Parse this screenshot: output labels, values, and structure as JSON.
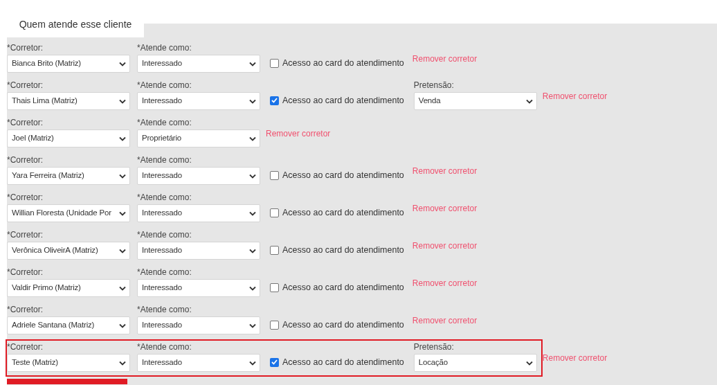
{
  "tab": {
    "label": "Quem atende esse cliente"
  },
  "rows": [
    {
      "corretor_label": "*Corretor:",
      "corretor": "Bianca Brito (Matriz)",
      "atende_label": "*Atende como:",
      "atende": "Interessado",
      "access": {
        "label": "Acesso ao card do atendimento",
        "checked": false
      },
      "remove": "Remover corretor",
      "highlighted": false
    },
    {
      "corretor_label": "*Corretor:",
      "corretor": "Thais Lima (Matriz)",
      "atende_label": "*Atende como:",
      "atende": "Interessado",
      "access": {
        "label": "Acesso ao card do atendimento",
        "checked": true
      },
      "pretensao": {
        "label": "Pretensão:",
        "value": "Venda"
      },
      "remove": "Remover corretor",
      "highlighted": false
    },
    {
      "corretor_label": "*Corretor:",
      "corretor": "Joel (Matriz)",
      "atende_label": "*Atende como:",
      "atende": "Proprietário",
      "remove": "Remover corretor",
      "highlighted": false
    },
    {
      "corretor_label": "*Corretor:",
      "corretor": "Yara Ferreira (Matriz)",
      "atende_label": "*Atende como:",
      "atende": "Interessado",
      "access": {
        "label": "Acesso ao card do atendimento",
        "checked": false
      },
      "remove": "Remover corretor",
      "highlighted": false
    },
    {
      "corretor_label": "*Corretor:",
      "corretor": "Willian Floresta (Unidade Por",
      "atende_label": "*Atende como:",
      "atende": "Interessado",
      "access": {
        "label": "Acesso ao card do atendimento",
        "checked": false
      },
      "remove": "Remover corretor",
      "highlighted": false
    },
    {
      "corretor_label": "*Corretor:",
      "corretor": "Verônica OliveirA (Matriz)",
      "atende_label": "*Atende como:",
      "atende": "Interessado",
      "access": {
        "label": "Acesso ao card do atendimento",
        "checked": false
      },
      "remove": "Remover corretor",
      "highlighted": false
    },
    {
      "corretor_label": "*Corretor:",
      "corretor": "Valdir Primo (Matriz)",
      "atende_label": "*Atende como:",
      "atende": "Interessado",
      "access": {
        "label": "Acesso ao card do atendimento",
        "checked": false
      },
      "remove": "Remover corretor",
      "highlighted": false
    },
    {
      "corretor_label": "*Corretor:",
      "corretor": "Adriele Santana (Matriz)",
      "atende_label": "*Atende como:",
      "atende": "Interessado",
      "access": {
        "label": "Acesso ao card do atendimento",
        "checked": false
      },
      "remove": "Remover corretor",
      "highlighted": false
    },
    {
      "corretor_label": "*Corretor:",
      "corretor": "Teste (Matriz)",
      "atende_label": "*Atende como:",
      "atende": "Interessado",
      "access": {
        "label": "Acesso ao card do atendimento",
        "checked": true
      },
      "pretensao": {
        "label": "Pretensão:",
        "value": "Locação"
      },
      "remove": "Remover corretor",
      "highlighted": true
    }
  ]
}
